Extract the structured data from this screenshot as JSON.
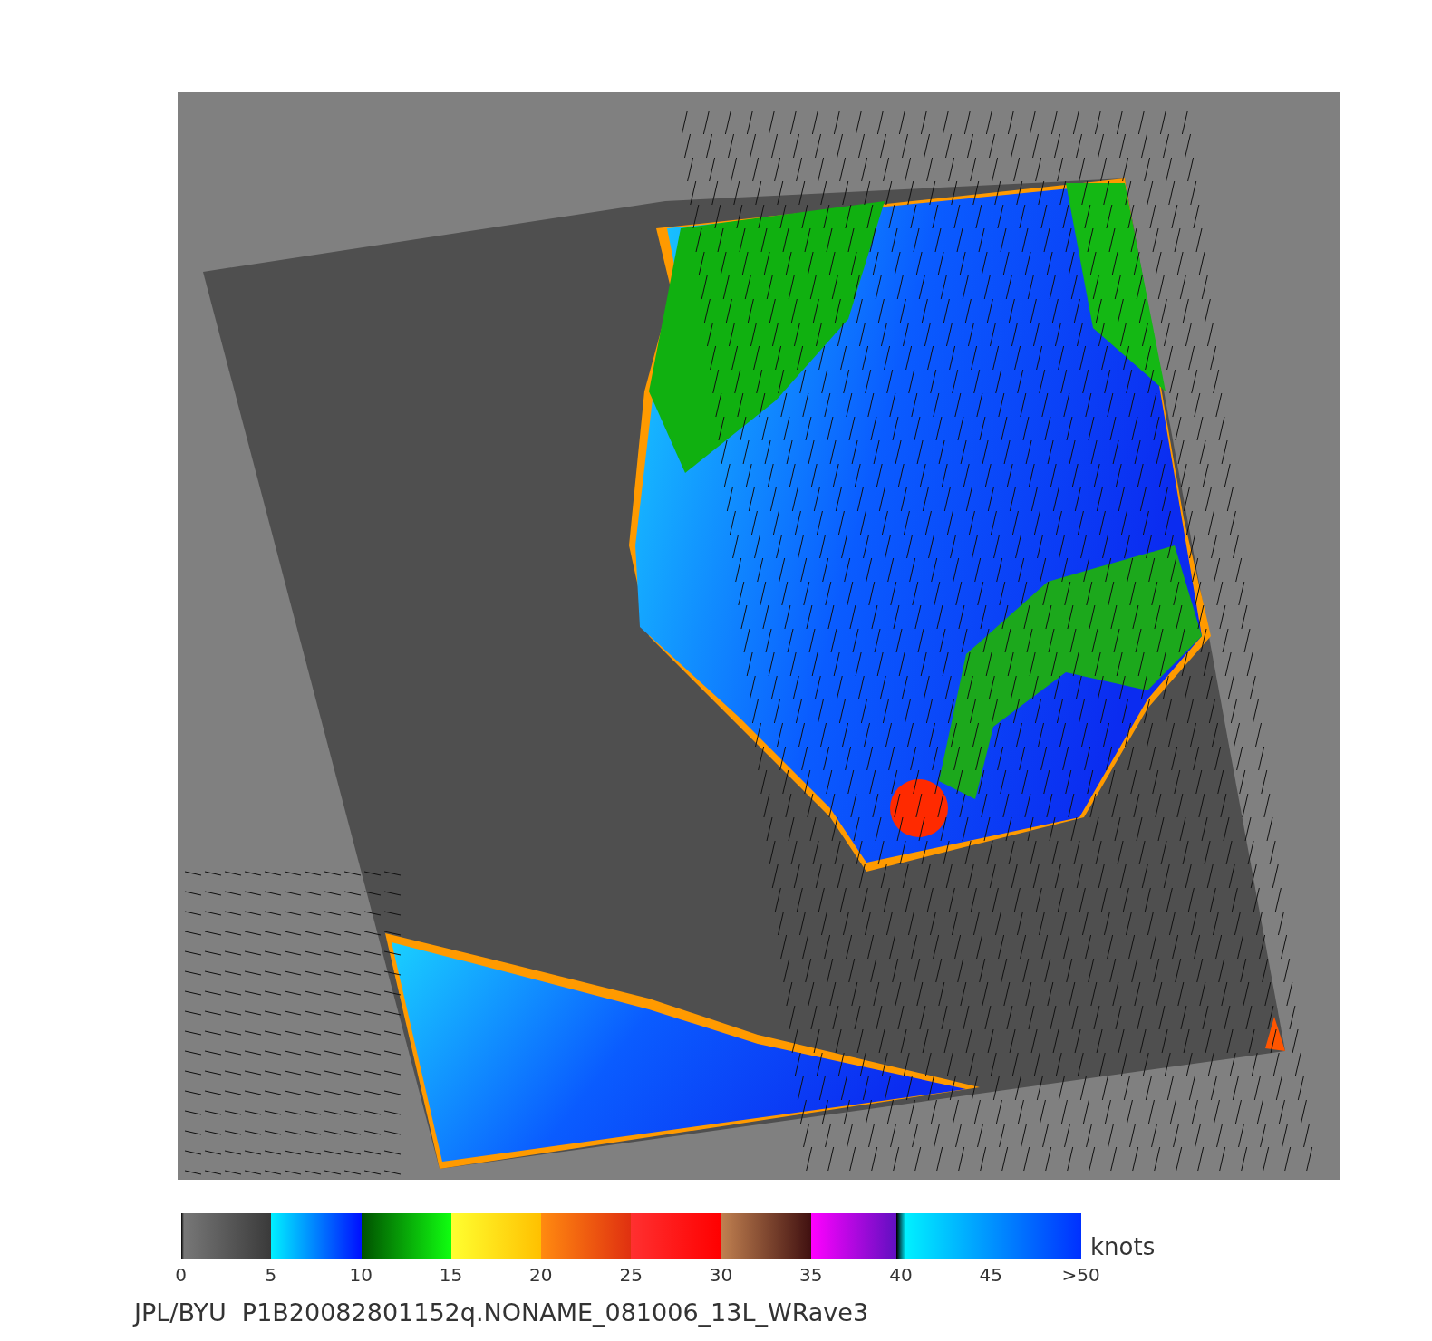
{
  "colorbar": {
    "ticks": [
      "0",
      "5",
      "10",
      "15",
      "20",
      "25",
      "30",
      "35",
      "40",
      "45",
      ">50"
    ],
    "unit": "knots"
  },
  "caption": "JPL/BYU  P1B20082801152q.NONAME_081006_13L_WRave3"
}
